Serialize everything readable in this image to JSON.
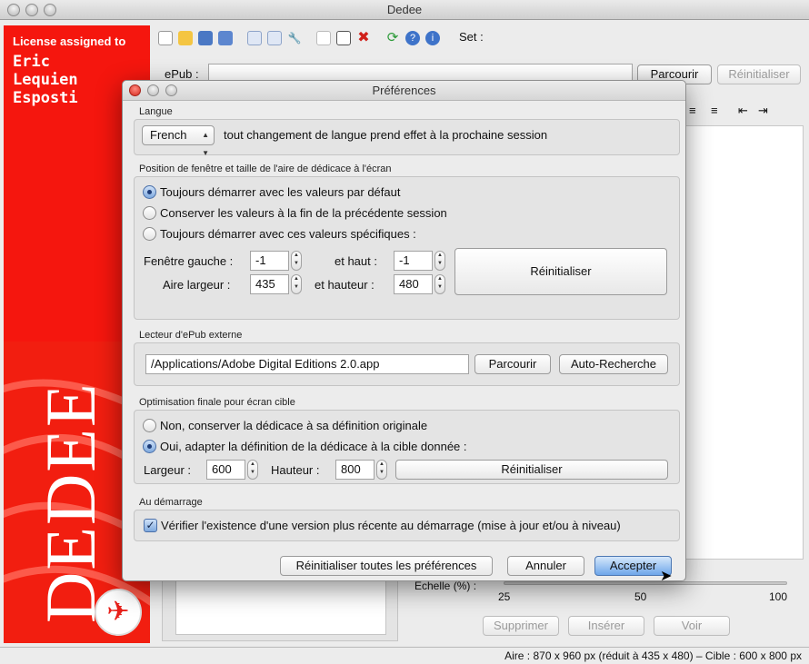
{
  "window": {
    "title": "Dedee"
  },
  "sidebar": {
    "license_label": "License assigned to",
    "license_name": [
      "Eric",
      "Lequien",
      "Esposti"
    ],
    "banner_text": "DEDEE"
  },
  "toolbar": {
    "icons": [
      "new-document-icon",
      "open-folder-icon",
      "save-icon",
      "save-all-icon",
      "copy-icon",
      "paste-icon",
      "wrench-icon",
      "edit-icon",
      "window-icon",
      "delete-icon",
      "refresh-icon",
      "help-icon",
      "info-icon"
    ],
    "set_label": "Set :"
  },
  "epub": {
    "label": "ePub :",
    "browse_label": "Parcourir",
    "reset_label": "Réinitialiser"
  },
  "scale": {
    "label": "Echelle (%) :",
    "ticks": [
      "25",
      "50",
      "100"
    ]
  },
  "actions": {
    "delete_label": "Supprimer",
    "insert_label": "Insérer",
    "view_label": "Voir"
  },
  "status": {
    "text": "Aire : 870 x 960 px (réduit à 435 x 480) – Cible : 600 x 800 px"
  },
  "dialog": {
    "title": "Préférences",
    "language": {
      "section_label": "Langue",
      "selected": "French",
      "note": "tout changement de langue prend effet à la prochaine session"
    },
    "window_position": {
      "section_label": "Position de fenêtre et taille de l'aire de dédicace à l'écran",
      "options": [
        "Toujours démarrer avec les valeurs par défaut",
        "Conserver les valeurs à la fin de la précédente session",
        "Toujours démarrer avec ces valeurs spécifiques :"
      ],
      "left_label": "Fenêtre gauche :",
      "left_value": "-1",
      "top_label": "et haut :",
      "top_value": "-1",
      "width_label": "Aire largeur :",
      "width_value": "435",
      "height_label": "et hauteur :",
      "height_value": "480",
      "reset_label": "Réinitialiser"
    },
    "external_reader": {
      "section_label": "Lecteur d'ePub externe",
      "path": "/Applications/Adobe Digital Editions 2.0.app",
      "browse_label": "Parcourir",
      "auto_label": "Auto-Recherche"
    },
    "optimization": {
      "section_label": "Optimisation finale pour écran cible",
      "options": [
        "Non, conserver la dédicace à sa définition originale",
        "Oui, adapter la définition de la dédicace à la cible donnée :"
      ],
      "width_label": "Largeur :",
      "width_value": "600",
      "height_label": "Hauteur :",
      "height_value": "800",
      "reset_label": "Réinitialiser"
    },
    "startup": {
      "section_label": "Au démarrage",
      "check_label": "Vérifier l'existence d'une version plus récente au démarrage (mise à jour et/ou à niveau)"
    },
    "buttons": {
      "reset_all_label": "Réinitialiser toutes les préférences",
      "cancel_label": "Annuler",
      "accept_label": "Accepter"
    }
  }
}
